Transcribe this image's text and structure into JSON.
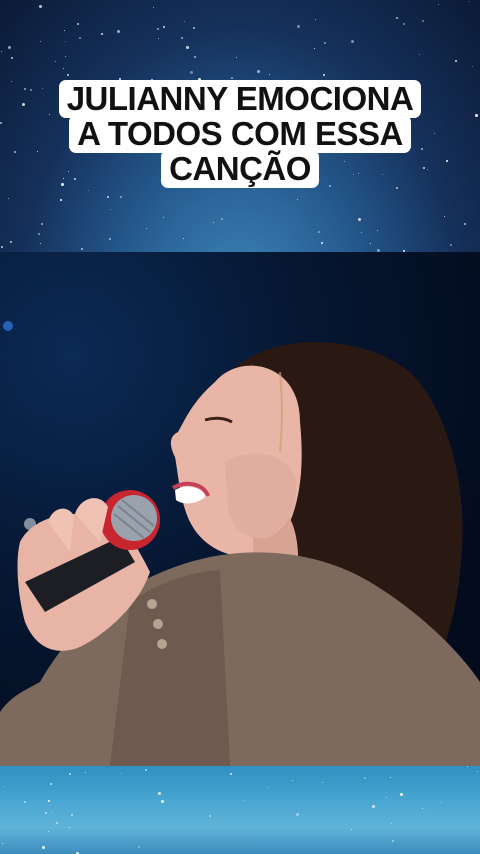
{
  "caption": {
    "lines": [
      "JULIANNY EMOCIONA",
      "A TODOS COM ESSA",
      "CANÇÃO"
    ]
  },
  "colors": {
    "caption_bg": "#ffffff",
    "caption_text": "#111111",
    "sky": "#15305a",
    "stage": "#061732"
  }
}
